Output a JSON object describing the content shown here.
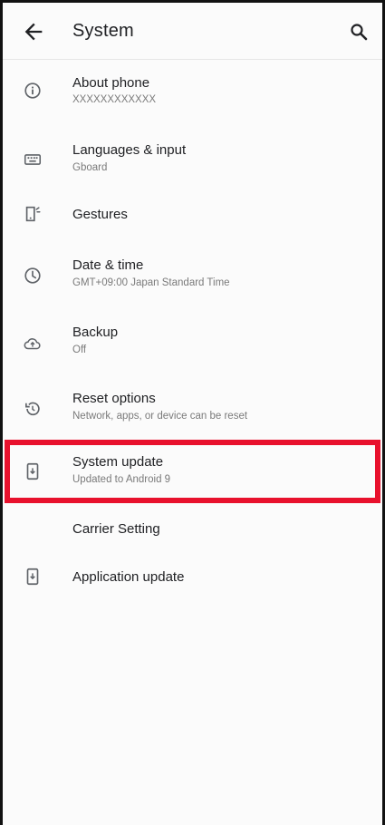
{
  "header": {
    "title": "System",
    "back_icon": "arrow-back-icon",
    "search_icon": "search-icon"
  },
  "items": [
    {
      "label": "About phone",
      "sub": "XXXXXXXXXXXX",
      "icon": "info-icon"
    },
    {
      "label": "Languages & input",
      "sub": "Gboard",
      "icon": "keyboard-icon"
    },
    {
      "label": "Gestures",
      "sub": "",
      "icon": "gestures-phone-icon"
    },
    {
      "label": "Date & time",
      "sub": "GMT+09:00 Japan Standard Time",
      "icon": "clock-icon"
    },
    {
      "label": "Backup",
      "sub": "Off",
      "icon": "cloud-backup-icon"
    },
    {
      "label": "Reset options",
      "sub": "Network, apps, or device can be reset",
      "icon": "restore-icon"
    },
    {
      "label": "System update",
      "sub": "Updated to Android 9",
      "icon": "system-update-icon"
    },
    {
      "label": "Carrier Setting",
      "sub": "",
      "icon": ""
    },
    {
      "label": "Application update",
      "sub": "",
      "icon": "app-update-icon"
    }
  ],
  "highlight_color": "#e8112d"
}
